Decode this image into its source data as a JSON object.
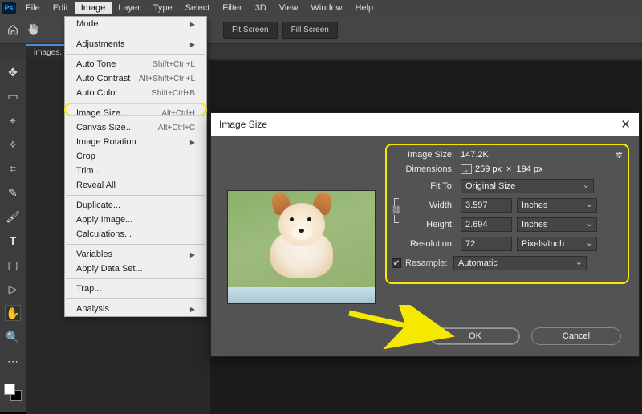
{
  "menubar": {
    "items": [
      "File",
      "Edit",
      "Image",
      "Layer",
      "Type",
      "Select",
      "Filter",
      "3D",
      "View",
      "Window",
      "Help"
    ],
    "activeIndex": 2
  },
  "toolbar": {
    "fit_screen": "Fit Screen",
    "fill_screen": "Fill Screen"
  },
  "doc_tab": "images.",
  "image_menu": {
    "mode": "Mode",
    "adjustments": "Adjustments",
    "auto_tone": {
      "label": "Auto Tone",
      "sc": "Shift+Ctrl+L"
    },
    "auto_contrast": {
      "label": "Auto Contrast",
      "sc": "Alt+Shift+Ctrl+L"
    },
    "auto_color": {
      "label": "Auto Color",
      "sc": "Shift+Ctrl+B"
    },
    "image_size": {
      "label": "Image Size...",
      "sc": "Alt+Ctrl+I"
    },
    "canvas_size": {
      "label": "Canvas Size...",
      "sc": "Alt+Ctrl+C"
    },
    "image_rotation": "Image Rotation",
    "crop": "Crop",
    "trim": "Trim...",
    "reveal_all": "Reveal All",
    "duplicate": "Duplicate...",
    "apply_image": "Apply Image...",
    "calculations": "Calculations...",
    "variables": "Variables",
    "apply_data_set": "Apply Data Set...",
    "trap": "Trap...",
    "analysis": "Analysis"
  },
  "dialog": {
    "title": "Image Size",
    "size_label": "Image Size:",
    "size_value": "147.2K",
    "dim_label": "Dimensions:",
    "dim_value_w": "259 px",
    "dim_value_h": "194 px",
    "dim_times": "×",
    "fit_label": "Fit To:",
    "fit_value": "Original Size",
    "width_label": "Width:",
    "width_value": "3.597",
    "width_unit": "Inches",
    "height_label": "Height:",
    "height_value": "2.694",
    "height_unit": "Inches",
    "res_label": "Resolution:",
    "res_value": "72",
    "res_unit": "Pixels/Inch",
    "resample_label": "Resample:",
    "resample_value": "Automatic",
    "ok": "OK",
    "cancel": "Cancel"
  }
}
